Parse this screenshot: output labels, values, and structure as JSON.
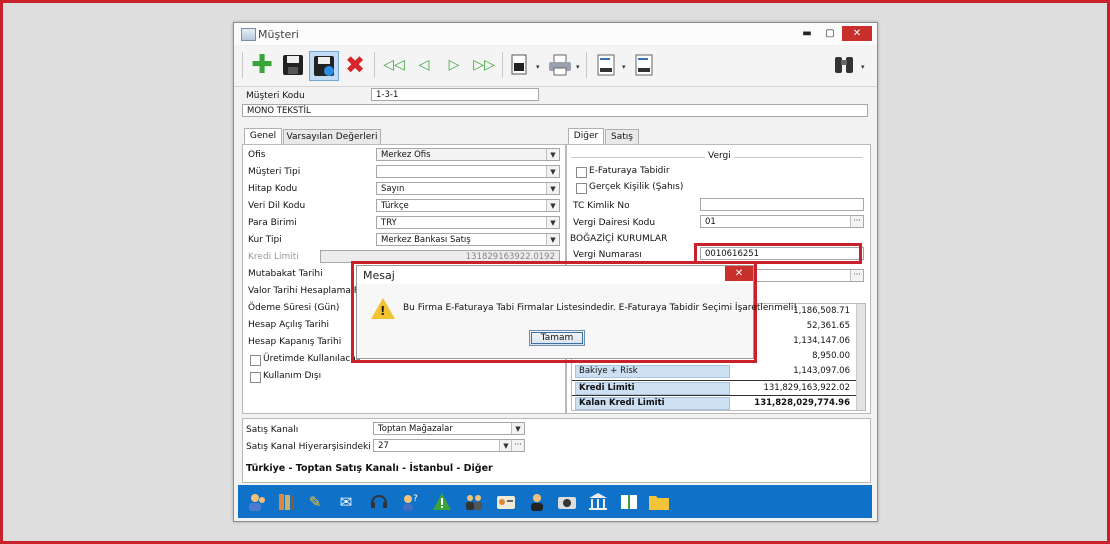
{
  "window": {
    "title": "Müşteri",
    "minimize": "▬",
    "maximize": "▢",
    "close": "✕"
  },
  "toolbar": {
    "buttons": [
      "add-icon",
      "save-icon",
      "save-close-icon",
      "delete-icon",
      "first-icon",
      "prev-icon",
      "next-icon",
      "last-icon",
      "print-preview-icon",
      "printer-icon",
      "report-icon",
      "report-design-icon",
      "binoculars-icon"
    ],
    "dropdown_glyph": "▾"
  },
  "header": {
    "musteri_kodu_label": "Müşteri Kodu",
    "musteri_kodu_value": "1-3-1",
    "musteri_adi_value": "MONO TEKSTİL"
  },
  "left_tabs": [
    "Genel",
    "Varsayılan Değerleri"
  ],
  "right_tabs": [
    "Diğer",
    "Satış"
  ],
  "genel": {
    "ofis": {
      "label": "Ofis",
      "value": "Merkez Ofis"
    },
    "musteri_tipi": {
      "label": "Müşteri Tipi",
      "value": ""
    },
    "hitap_kodu": {
      "label": "Hitap Kodu",
      "value": "Sayın"
    },
    "veri_dil_kodu": {
      "label": "Veri Dil Kodu",
      "value": "Türkçe"
    },
    "para_birimi": {
      "label": "Para Birimi",
      "value": "TRY"
    },
    "kur_tipi": {
      "label": "Kur Tipi",
      "value": "Merkez Bankası Satış"
    },
    "kredi_limiti": {
      "label": "Kredi Limiti",
      "value": "131829163922.0192"
    },
    "mutabakat_tarihi": "Mutabakat Tarihi",
    "valor_tarihi": "Valor Tarihi Hesaplama Fo",
    "odeme_suresi": "Ödeme Süresi (Gün)",
    "hesap_acilis": "Hesap Açılış Tarihi",
    "hesap_kapanis": "Hesap Kapanış Tarihi",
    "uretimde": "Üretimde Kullanılacak",
    "kullanim_disi": "Kullanım Dışı"
  },
  "diger": {
    "group_title": "Vergi",
    "efatura": "E-Faturaya Tabidir",
    "gercek_kisilik": "Gerçek Kişilik (Şahıs)",
    "tc_kimlik_label": "TC Kimlik No",
    "tc_kimlik_value": "",
    "vergi_dairesi_label": "Vergi Dairesi Kodu",
    "vergi_dairesi_value": "01",
    "vergi_dairesi_adi": "BOĞAZİÇİ KURUMLAR",
    "vergi_no_label": "Vergi Numarası",
    "vergi_no_value": "0010616251"
  },
  "risk_grid": [
    {
      "label": "",
      "value": "1,186,508.71"
    },
    {
      "label": "",
      "value": "52,361.65"
    },
    {
      "label": "",
      "value": "1,134,147.06"
    },
    {
      "label": "",
      "value": "8,950.00"
    },
    {
      "label": "Bakiye + Risk",
      "value": "1,143,097.06"
    },
    {
      "label": "Kredi Limiti",
      "value": "131,829,163,922.02"
    },
    {
      "label": "Kalan Kredi Limiti",
      "value": "131,828,029,774.96"
    }
  ],
  "footer": {
    "satis_kanali_label": "Satış Kanalı",
    "satis_kanali_value": "Toptan Mağazalar",
    "hiyerarsi_label": "Satış Kanal Hiyerarşisindeki Yeri",
    "hiyerarsi_value": "27",
    "path_text": "Türkiye - Toptan Satış Kanalı - İstanbul - Diğer"
  },
  "bottom_icons": [
    "users-icon",
    "books-icon",
    "pencil-icon",
    "mail-icon",
    "headset-icon",
    "help-user-icon",
    "warning-icon",
    "group-icon",
    "id-card-icon",
    "person-icon",
    "camera-icon",
    "bank-icon",
    "book-open-icon",
    "folder-icon"
  ],
  "dialog": {
    "title": "Mesaj",
    "close": "✕",
    "message": "Bu Firma E-Faturaya Tabi Firmalar Listesindedir. E-Faturaya Tabidir Seçimi İşaretlenmeli!",
    "ok_label": "Tamam"
  },
  "colors": {
    "highlight_red": "#c8212b",
    "bottom_bar": "#1071c8"
  }
}
